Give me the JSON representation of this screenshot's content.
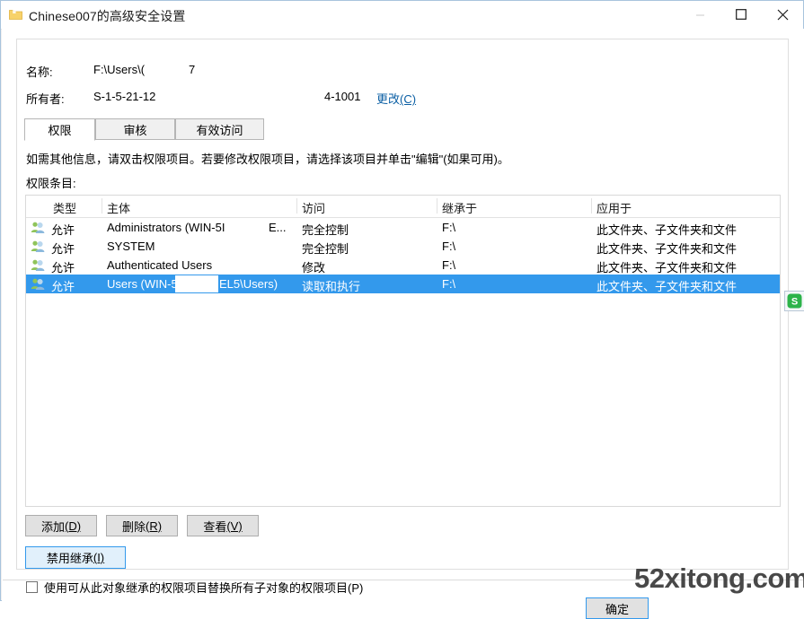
{
  "window": {
    "title": "Chinese007的高级安全设置",
    "icon": "folder-icon",
    "minimize_label": "—",
    "maximize_label": "□",
    "close_label": "✕"
  },
  "header": {
    "name_label": "名称:",
    "name_value": "F:\\Users\\(",
    "name_value_tail": "7",
    "owner_label": "所有者:",
    "owner_value": "S-1-5-21-12",
    "owner_value_tail": "4-1001",
    "change_link": "更改",
    "change_link_accel": "(C)"
  },
  "tabs": [
    {
      "label": "权限",
      "active": true
    },
    {
      "label": "审核",
      "active": false
    },
    {
      "label": "有效访问",
      "active": false
    }
  ],
  "instruction": "如需其他信息，请双击权限项目。若要修改权限项目，请选择该项目并单击\"编辑\"(如果可用)。",
  "entries_label": "权限条目:",
  "table": {
    "columns": [
      "类型",
      "主体",
      "访问",
      "继承于",
      "应用于"
    ],
    "rows": [
      {
        "icon": "group-users-icon",
        "type": "允许",
        "principal": "Administrators (WIN-5I",
        "principal_tail": "E...",
        "access": "完全控制",
        "inherited_from": "F:\\",
        "applies_to": "此文件夹、子文件夹和文件",
        "selected": false,
        "redacted": false
      },
      {
        "icon": "group-users-icon",
        "type": "允许",
        "principal": "SYSTEM",
        "principal_tail": "",
        "access": "完全控制",
        "inherited_from": "F:\\",
        "applies_to": "此文件夹、子文件夹和文件",
        "selected": false,
        "redacted": false
      },
      {
        "icon": "group-users-icon",
        "type": "允许",
        "principal": "Authenticated Users",
        "principal_tail": "",
        "access": "修改",
        "inherited_from": "F:\\",
        "applies_to": "此文件夹、子文件夹和文件",
        "selected": false,
        "redacted": false
      },
      {
        "icon": "group-users-icon",
        "type": "允许",
        "principal": "Users (WIN-5I",
        "principal_tail": "EL5\\Users)",
        "access": "读取和执行",
        "inherited_from": "F:\\",
        "applies_to": "此文件夹、子文件夹和文件",
        "selected": true,
        "redacted": true
      }
    ]
  },
  "buttons": {
    "add": "添加",
    "add_accel": "(D)",
    "remove": "删除",
    "remove_accel": "(R)",
    "view": "查看",
    "view_accel": "(V)",
    "disable_inheritance": "禁用继承",
    "disable_inheritance_accel": "(I)",
    "ok": "确定"
  },
  "checkbox": {
    "label": "使用可从此对象继承的权限项目替换所有子对象的权限项目",
    "label_accel": "(P)",
    "checked": false
  },
  "watermark": "52xitong.com",
  "ime": {
    "name": "sogou-ime-icon",
    "glyph": "S"
  },
  "colors": {
    "selection": "#3399ec",
    "link": "#0b5fa4",
    "focus_border": "#3399ec",
    "window_border": "#a8c4dd",
    "button_face": "#e1e1e1",
    "focus_button_face": "#e1f0fb"
  }
}
